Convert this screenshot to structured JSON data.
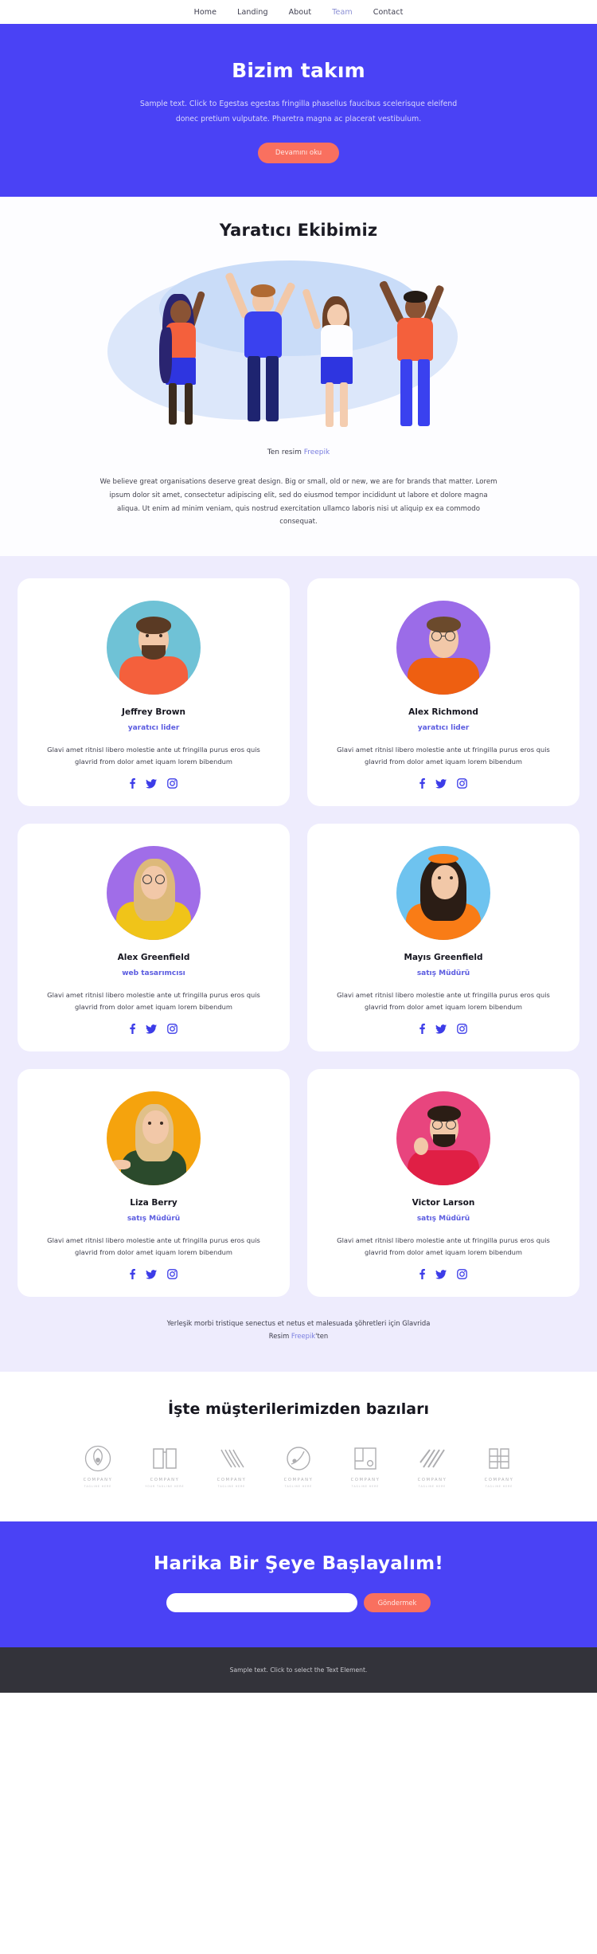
{
  "nav": {
    "items": [
      {
        "label": "Home",
        "active": false
      },
      {
        "label": "Landing",
        "active": false
      },
      {
        "label": "About",
        "active": false
      },
      {
        "label": "Team",
        "active": true
      },
      {
        "label": "Contact",
        "active": false
      }
    ]
  },
  "hero": {
    "title": "Bizim takım",
    "subtitle": "Sample text. Click to Egestas egestas fringilla phasellus faucibus scelerisque eleifend donec pretium vulputate. Pharetra magna ac placerat vestibulum.",
    "cta_label": "Devamını oku"
  },
  "creative": {
    "title": "Yaratıcı Ekibimiz",
    "image_caption_prefix": "Ten resim ",
    "image_caption_link": "Freepik",
    "body": "We believe great organisations deserve great design. Big or small, old or new, we are for brands that matter. Lorem ipsum dolor sit amet, consectetur adipiscing elit, sed do eiusmod tempor incididunt ut labore et dolore magna aliqua. Ut enim ad minim veniam, quis nostrud exercitation ullamco laboris nisi ut aliquip ex ea commodo consequat."
  },
  "team": {
    "members": [
      {
        "name": "Jeffrey Brown",
        "role": "yaratıcı lider",
        "desc": "Glavi amet ritnisl libero molestie ante ut fringilla purus eros quis glavrid from dolor amet iquam lorem bibendum",
        "avatar_bg": "#6fc2d6",
        "shirt": "#f4603c",
        "hair": "#5a3a24",
        "beard": true,
        "glasses": false,
        "hair_long": false
      },
      {
        "name": "Alex Richmond",
        "role": "yaratıcı lider",
        "desc": "Glavi amet ritnisl libero molestie ante ut fringilla purus eros quis glavrid from dolor amet iquam lorem bibendum",
        "avatar_bg": "#9b6ce8",
        "shirt": "#ee5f11",
        "hair": "#6b4a2c",
        "beard": false,
        "glasses": true,
        "hair_long": false
      },
      {
        "name": "Alex Greenfield",
        "role": "web tasarımcısı",
        "desc": "Glavi amet ritnisl libero molestie ante ut fringilla purus eros quis glavrid from dolor amet iquam lorem bibendum",
        "avatar_bg": "#a06de8",
        "shirt": "#f2c породы",
        "hair": "#ddb97a",
        "beard": false,
        "glasses": true,
        "hair_long": true
      },
      {
        "name": "Mayıs Greenfield",
        "role": "satış Müdürü",
        "desc": "Glavi amet ritnisl libero molestie ante ut fringilla purus eros quis glavrid from dolor amet iquam lorem bibendum",
        "avatar_bg": "#6ec3ef",
        "shirt": "#f97c16",
        "hair": "#2b1d15",
        "beard": false,
        "glasses": false,
        "hair_long": true
      },
      {
        "name": "Liza Berry",
        "role": "satış Müdürü",
        "desc": "Glavi amet ritnisl libero molestie ante ut fringilla purus eros quis glavrid from dolor amet iquam lorem bibendum",
        "avatar_bg": "#f5a30d",
        "shirt": "#2b4a2c",
        "hair": "#e0c089",
        "beard": false,
        "glasses": false,
        "hair_long": true
      },
      {
        "name": "Victor Larson",
        "role": "satış Müdürü",
        "desc": "Glavi amet ritnisl libero molestie ante ut fringilla purus eros quis glavrid from dolor amet iquam lorem bibendum",
        "avatar_bg": "#e8457e",
        "shirt": "#e01f45",
        "hair": "#2b1d15",
        "beard": true,
        "glasses": true,
        "hair_long": false
      }
    ],
    "socials": [
      "facebook-icon",
      "twitter-icon",
      "instagram-icon"
    ],
    "footer_line1": "Yerleşik morbi tristique senectus et netus et malesuada şöhretleri için Glavrida",
    "footer_line2_prefix": "Resim ",
    "footer_line2_link": "Freepik",
    "footer_line2_suffix": "'ten"
  },
  "clients": {
    "title": "İşte müşterilerimizden bazıları",
    "logos": [
      {
        "name": "COMPANY",
        "tagline": "TAGLINE HERE",
        "icon": "leaf-circle-logo"
      },
      {
        "name": "COMPANY",
        "tagline": "YOUR TAGLINE HERE",
        "icon": "book-logo"
      },
      {
        "name": "COMPANY",
        "tagline": "TAGLINE HERE",
        "icon": "wave-lines-logo"
      },
      {
        "name": "COMPANY",
        "tagline": "TAGLINE HERE",
        "icon": "circle-swoosh-logo"
      },
      {
        "name": "COMPANY",
        "tagline": "TAGLINE HERE",
        "icon": "square-corner-logo"
      },
      {
        "name": "COMPANY",
        "tagline": "TAGLINE HERE",
        "icon": "diagonal-stripes-logo"
      },
      {
        "name": "COMPANY",
        "tagline": "TAGLINE HERE",
        "icon": "bracket-logo"
      }
    ]
  },
  "cta": {
    "title": "Harika Bir Şeye Başlayalım!",
    "input_value": "",
    "input_placeholder": "",
    "submit_label": "Göndermek"
  },
  "footer": {
    "text": "Sample text. Click to select the Text Element."
  },
  "colors": {
    "brand_blue": "#4a42f5",
    "coral": "#f9705f",
    "team_bg": "#eeecfd",
    "footer_bg": "#33333a",
    "link": "#7b7fe0"
  }
}
